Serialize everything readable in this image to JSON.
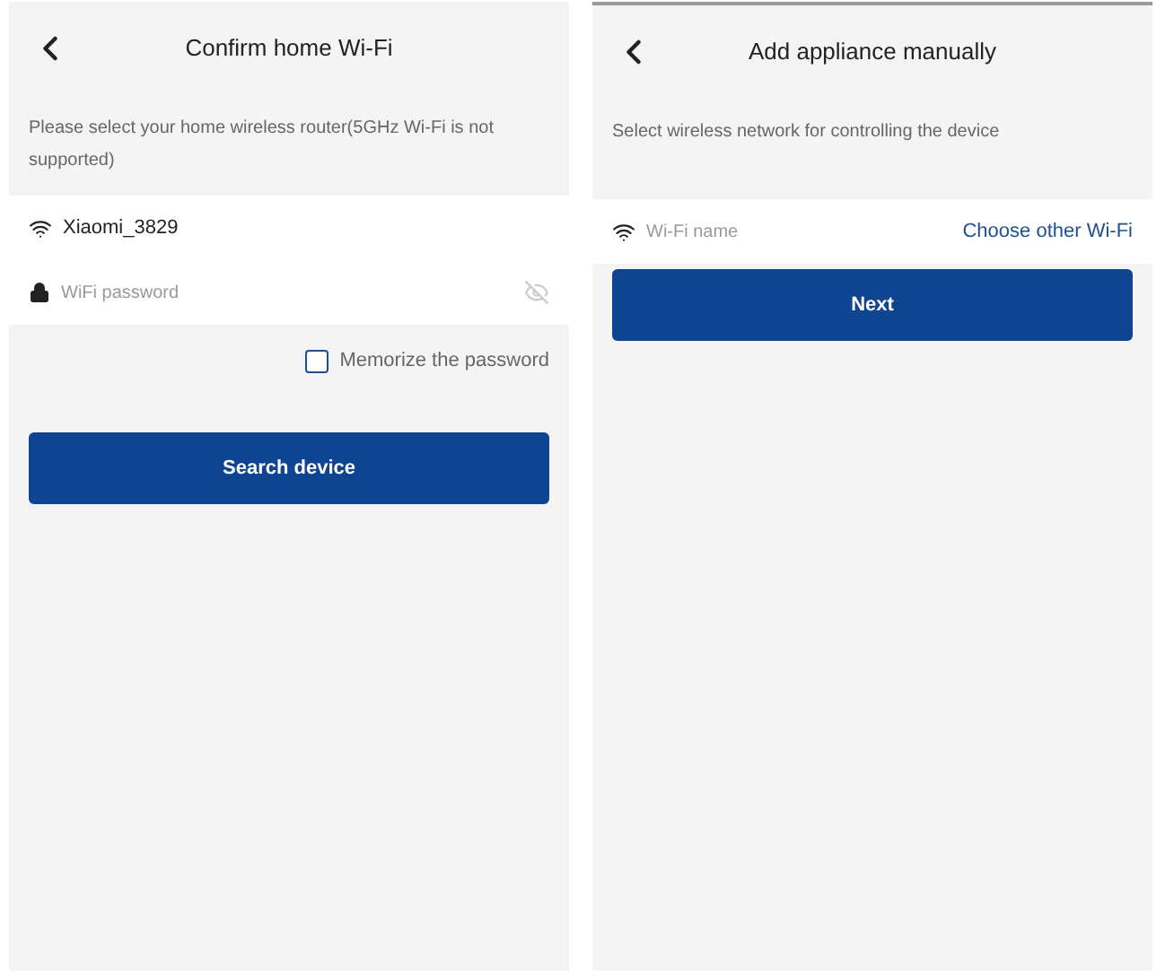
{
  "screens": [
    {
      "title": "Confirm home Wi-Fi",
      "description": "Please select your home wireless router(5GHz Wi-Fi is not supported)",
      "network": {
        "name": "Xiaomi_3829"
      },
      "password": {
        "placeholder": "WiFi password"
      },
      "memorize": {
        "label": "Memorize the password",
        "checked": false
      },
      "button": "Search device"
    },
    {
      "title": "Add appliance manually",
      "description": "Select wireless network for controlling the device",
      "network": {
        "placeholder": "Wi-Fi name",
        "link": "Choose other Wi-Fi"
      },
      "button": "Next"
    }
  ]
}
